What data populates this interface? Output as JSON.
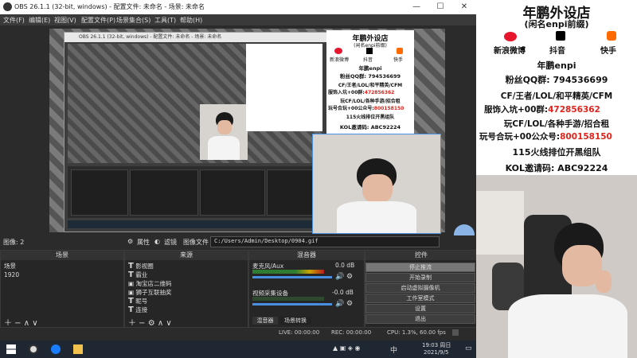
{
  "window": {
    "title": "OBS 26.1.1 (32-bit, windows) - 配置文件: 未命名 - 场景: 未命名",
    "min": "—",
    "max": "☐",
    "close": "✕"
  },
  "menu": [
    {
      "label": "文件(F)"
    },
    {
      "label": "编辑(E)"
    },
    {
      "label": "视图(V)"
    },
    {
      "label": "配置文件(P)"
    },
    {
      "label": "场景集合(S)"
    },
    {
      "label": "工具(T)"
    },
    {
      "label": "帮助(H)"
    }
  ],
  "preview": {
    "nested_title": "OBS 26.1.1 (32-bit, windows) - 配置文件: 未命名 - 场景: 未命名",
    "banner": {
      "title": "年鹏外设店",
      "subtitle": "(闲名enpi前缀)",
      "socials": [
        "新浪微博",
        "抖音",
        "快手"
      ],
      "name": "年鹏enpi",
      "qq": "粉丝QQ群: 794536699",
      "line1": "CF/王者/LOL/和平精英/CFM",
      "line2a": "服饰入坑+00群:",
      "line2b": "472856362",
      "line3": "玩CF/LOL/各种手游/招合租",
      "line4a": "玩号合玩+00公众号:",
      "line4b": "800158150",
      "line5": "115火线排位开黑组队",
      "line6": "KOL邀请码: ABC92224"
    }
  },
  "image_bar": {
    "label": "图像: 2",
    "properties": "属性",
    "filters": "滤镜",
    "image_file": "图像文件",
    "path": "C:/Users/Admin/Desktop/0904.gif"
  },
  "scenes": {
    "header": "场景",
    "items": [
      "场景",
      "1920"
    ]
  },
  "sources": {
    "header": "来源",
    "items": [
      "影视圈",
      "霸业",
      "淘宝店二维码",
      "狮子互联抽奖",
      "昵号",
      "连接"
    ]
  },
  "mixer": {
    "header": "混音器",
    "ch1": "麦克风/Aux",
    "ch1_db": "0.0 dB",
    "ch2": "视频采集设备",
    "ch2_db": "-0.0 dB",
    "tabs": [
      "混音器",
      "场景转换"
    ]
  },
  "controls": {
    "header": "控件",
    "buttons": [
      "停止推流",
      "开始录制",
      "启动虚拟摄像机",
      "工作室模式",
      "设置",
      "退出"
    ]
  },
  "status": {
    "live": "LIVE: 00:00:00",
    "rec": "REC: 00:00:00",
    "cpu": "CPU: 1.3%, 60.00 fps"
  },
  "taskbar": {
    "time": "19:03 周日",
    "date": "2021/9/5",
    "lang": "中"
  },
  "banner": {
    "title": "年鹏外设店",
    "subtitle": "(闲名enpi前缀)",
    "socials": [
      "新浪微博",
      "抖音",
      "快手"
    ],
    "name": "年鹏enpi",
    "qq": "粉丝QQ群: 794536699",
    "line1": "CF/王者/LOL/和平精英/CFM",
    "line2a": "服饰入坑+00群:",
    "line2b": "472856362",
    "line3": "玩CF/LOL/各种手游/招合租",
    "line4a": "玩号合玩+00公众号:",
    "line4b": "800158150",
    "line5": "115火线排位开黑组队",
    "line6": "KOL邀请码: ABC92224"
  },
  "colors": {
    "accent_red": "#e0241c",
    "obs_dark": "#2b2b2b",
    "selection_blue": "#4a90e2"
  }
}
